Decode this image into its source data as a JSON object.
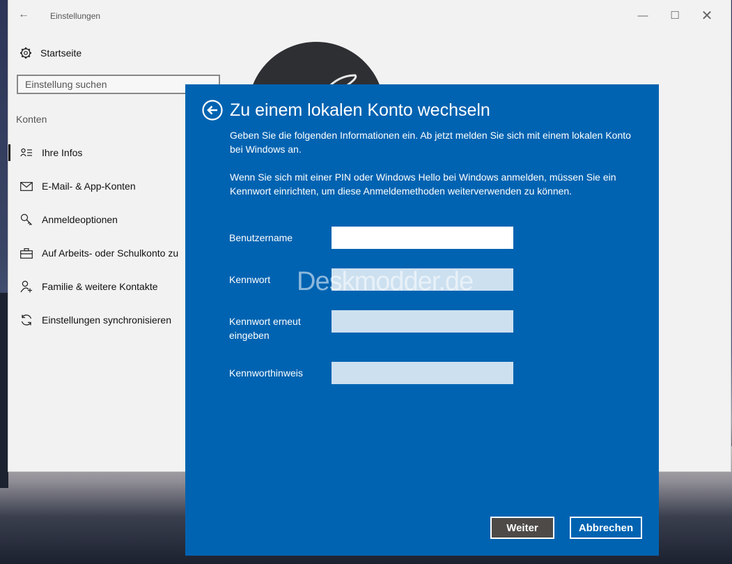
{
  "window": {
    "title": "Einstellungen",
    "back_icon": "back-arrow-icon",
    "minimize_glyph": "—",
    "maximize_glyph": "☐",
    "close_glyph": "✕"
  },
  "sidebar": {
    "home_label": "Startseite",
    "search_placeholder": "Einstellung suchen",
    "section_label": "Konten",
    "items": [
      {
        "label": "Ihre Infos",
        "icon": "person-card-icon",
        "active": true
      },
      {
        "label": "E-Mail- & App-Konten",
        "icon": "mail-icon",
        "active": false
      },
      {
        "label": "Anmeldeoptionen",
        "icon": "key-icon",
        "active": false
      },
      {
        "label": "Auf Arbeits- oder Schulkonto zu",
        "icon": "briefcase-icon",
        "active": false
      },
      {
        "label": "Familie & weitere Kontakte",
        "icon": "person-add-icon",
        "active": false
      },
      {
        "label": "Einstellungen synchronisieren",
        "icon": "sync-icon",
        "active": false
      }
    ]
  },
  "dialog": {
    "title": "Zu einem lokalen Konto wechseln",
    "paragraph1": "Geben Sie die folgenden Informationen ein. Ab jetzt melden Sie sich mit einem lokalen Konto bei Windows an.",
    "paragraph2": "Wenn Sie sich mit einer PIN oder Windows Hello bei Windows anmelden, müssen Sie ein Kennwort einrichten, um diese Anmeldemethoden weiterverwenden zu können.",
    "fields": [
      {
        "label": "Benutzername",
        "value": ""
      },
      {
        "label": "Kennwort",
        "value": ""
      },
      {
        "label": "Kennwort erneut eingeben",
        "value": ""
      },
      {
        "label": "Kennworthinweis",
        "value": ""
      }
    ],
    "next_label": "Weiter",
    "cancel_label": "Abbrechen"
  },
  "watermark": "Deskmodder.de",
  "colors": {
    "dialog_bg": "#0063b1",
    "window_bg": "#f2f2f2",
    "next_button_bg": "#4d4a48"
  }
}
